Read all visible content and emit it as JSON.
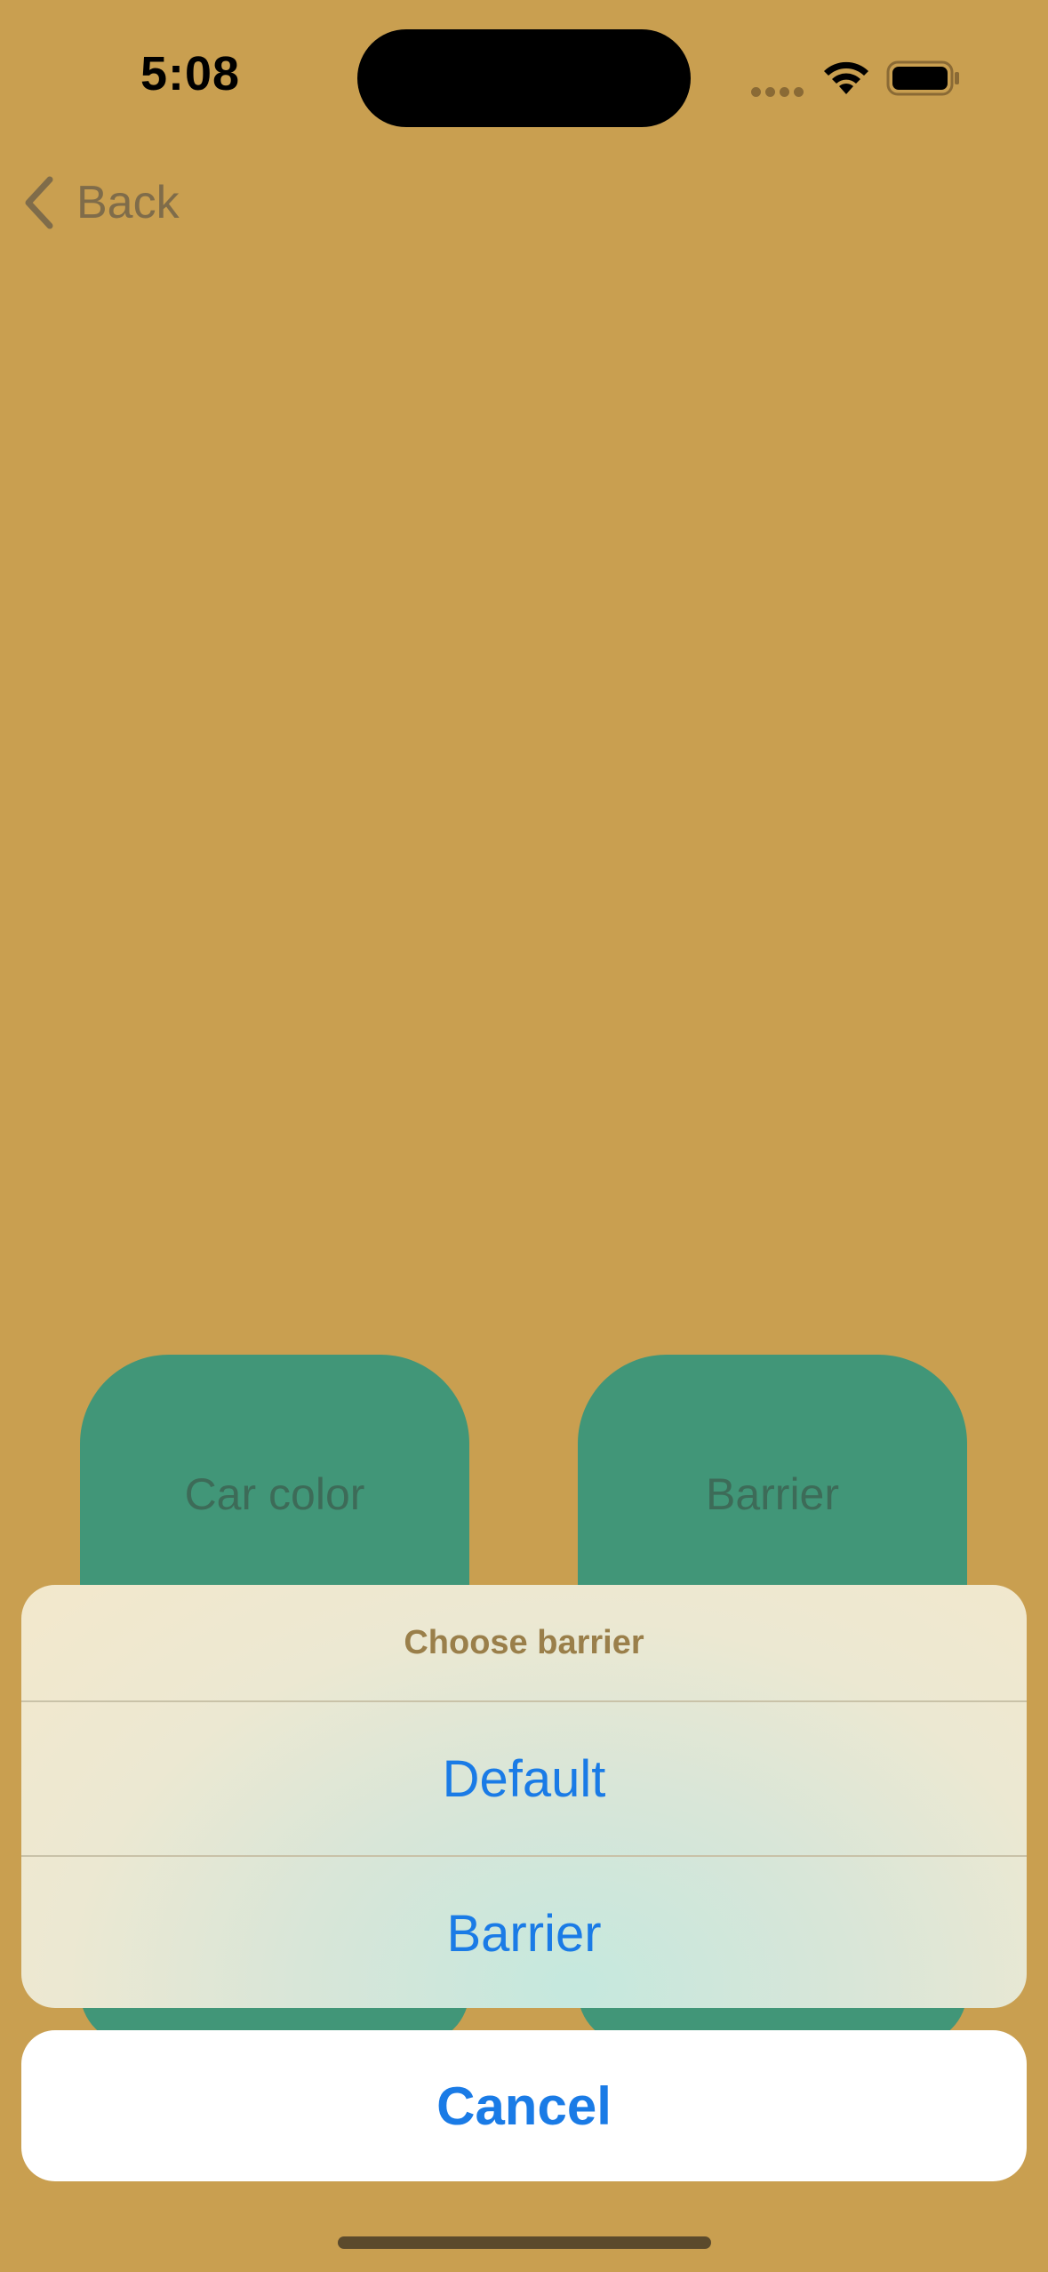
{
  "status_bar": {
    "time": "5:08"
  },
  "nav": {
    "back_label": "Back"
  },
  "tiles": [
    {
      "label": "Car color"
    },
    {
      "label": "Barrier"
    }
  ],
  "action_sheet": {
    "title": "Choose barrier",
    "options": [
      "Default",
      "Barrier"
    ],
    "cancel_label": "Cancel"
  },
  "colors": {
    "background": "#C99F50",
    "tile": "#419678",
    "action_text": "#1A7BE6"
  }
}
